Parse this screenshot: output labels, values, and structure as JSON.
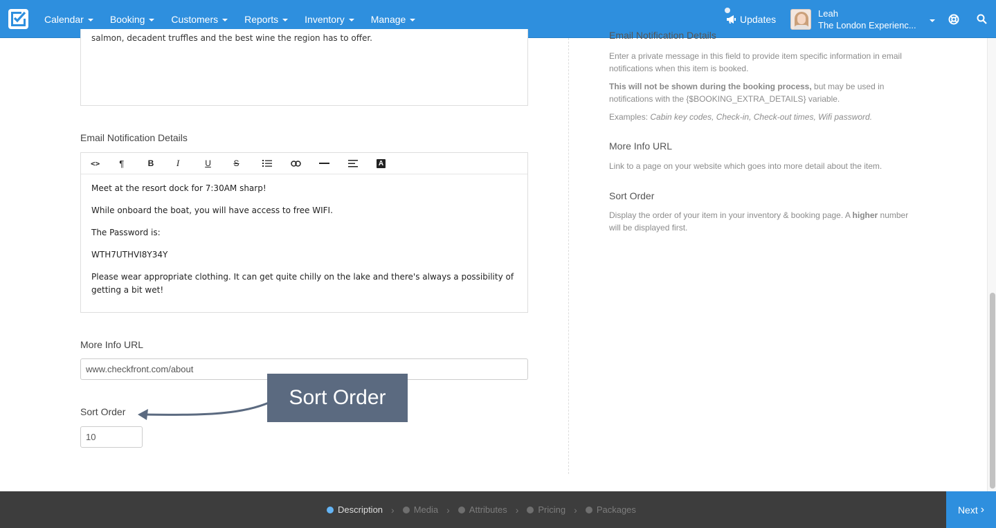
{
  "nav": {
    "items": [
      "Calendar",
      "Booking",
      "Customers",
      "Reports",
      "Inventory",
      "Manage"
    ],
    "updates_label": "Updates",
    "user_name": "Leah",
    "user_company": "The London Experienc...",
    "brand_color": "#2e8fde"
  },
  "description_box": {
    "visible_text": "salmon, decadent truffles and the best wine the region has to offer."
  },
  "email_notification": {
    "label": "Email Notification Details",
    "toolbar": [
      "code-view",
      "paragraph",
      "bold",
      "italic",
      "underline",
      "strikethrough",
      "list",
      "link",
      "horizontal-rule",
      "align",
      "font-color"
    ],
    "toolbar_glyphs": [
      "<>",
      "¶",
      "B",
      "I",
      "U",
      "S",
      "☰",
      "⊂⊃",
      "—",
      "≡",
      "A"
    ],
    "paragraphs": [
      "Meet at the resort dock for 7:30AM sharp!",
      "While onboard the boat, you will have access to free WIFI.",
      "The Password is:",
      "WTH7UTHVI8Y34Y",
      "Please wear appropriate clothing. It can get quite chilly on the lake and there's always a possibility of getting a bit wet!"
    ]
  },
  "more_info": {
    "label": "More Info URL",
    "value": "www.checkfront.com/about"
  },
  "sort_order": {
    "label": "Sort Order",
    "value": "10"
  },
  "callout": {
    "text": "Sort Order"
  },
  "help": {
    "email_heading": "Email Notification Details",
    "email_p1": "Enter a private message in this field to provide item specific information in email notifications when this item is booked.",
    "email_p2_bold": "This will not be shown during the booking process,",
    "email_p2_rest": " but may be used in notifications with the {$BOOKING_EXTRA_DETAILS} variable.",
    "email_p3_prefix": "Examples: ",
    "email_p3_italic": "Cabin key codes, Check-in, Check-out times, Wifi password.",
    "more_info_heading": "More Info URL",
    "more_info_text": "Link to a page on your website which goes into more detail about the item.",
    "sort_heading": "Sort Order",
    "sort_text_a": "Display the order of your item in your inventory & booking page. A ",
    "sort_text_bold": "higher",
    "sort_text_b": " number will be displayed first."
  },
  "steps": [
    "Description",
    "Media",
    "Attributes",
    "Pricing",
    "Packages"
  ],
  "active_step": "Description",
  "next_label": "Next"
}
